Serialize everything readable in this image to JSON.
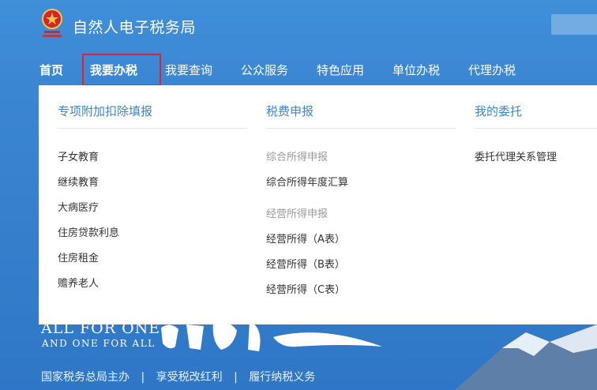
{
  "header": {
    "site_title": "自然人电子税务局",
    "emblem_icon": "tax-emblem-icon"
  },
  "nav": {
    "items": [
      {
        "label": "首页",
        "active": true
      },
      {
        "label": "我要办税",
        "highlighted": true
      },
      {
        "label": "我要查询"
      },
      {
        "label": "公众服务"
      },
      {
        "label": "特色应用"
      },
      {
        "label": "单位办税"
      },
      {
        "label": "代理办税"
      }
    ]
  },
  "dropdown": {
    "columns": [
      {
        "title": "专项附加扣除填报",
        "items": [
          "子女教育",
          "继续教育",
          "大病医疗",
          "住房贷款利息",
          "住房租金",
          "赡养老人"
        ]
      },
      {
        "title": "税费申报",
        "groups": [
          {
            "label": "综合所得申报",
            "items": [
              "综合所得年度汇算"
            ]
          },
          {
            "label": "经营所得申报",
            "items": [
              "经营所得（A表）",
              "经营所得（B表）",
              "经营所得（C表）"
            ]
          }
        ]
      },
      {
        "title": "我的委托",
        "items": [
          "委托代理关系管理"
        ]
      }
    ]
  },
  "banner": {
    "slogan_en_1": "ALL FOR ONE",
    "slogan_en_2": "AND ONE FOR ALL",
    "bottom_items": [
      "国家税务总局主办",
      "|",
      "享受税改红利",
      "|",
      "履行纳税义务"
    ]
  },
  "colors": {
    "header_bg": "#3f8fd9",
    "link_title": "#3d86c8",
    "highlight_border": "#d6262e"
  }
}
